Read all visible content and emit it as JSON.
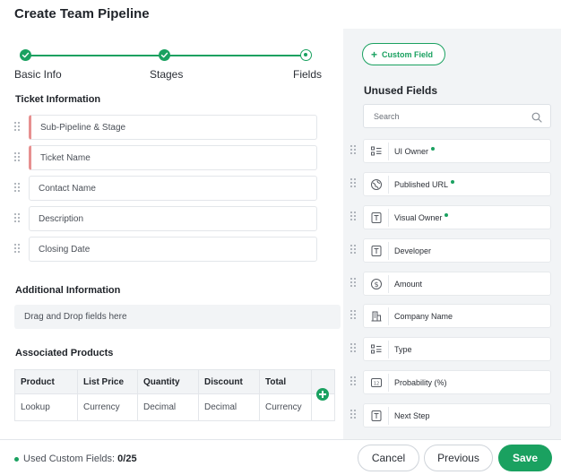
{
  "title": "Create Team Pipeline",
  "stepper": {
    "steps": [
      {
        "label": "Basic Info",
        "state": "done"
      },
      {
        "label": "Stages",
        "state": "done"
      },
      {
        "label": "Fields",
        "state": "current"
      }
    ]
  },
  "ticket_info": {
    "title": "Ticket Information",
    "fields": [
      {
        "label": "Sub-Pipeline & Stage",
        "required": true
      },
      {
        "label": "Ticket Name",
        "required": true
      },
      {
        "label": "Contact Name",
        "required": false
      },
      {
        "label": "Description",
        "required": false
      },
      {
        "label": "Closing Date",
        "required": false
      }
    ]
  },
  "additional_info": {
    "title": "Additional Information",
    "drop_text": "Drag and Drop fields here"
  },
  "products": {
    "title": "Associated Products",
    "columns": [
      "Product",
      "List Price",
      "Quantity",
      "Discount",
      "Total"
    ],
    "row": [
      "Lookup",
      "Currency",
      "Decimal",
      "Decimal",
      "Currency"
    ]
  },
  "right_panel": {
    "custom_field_button": "Custom Field",
    "unused_title": "Unused Fields",
    "search_placeholder": "Search",
    "items": [
      {
        "label": "UI Owner",
        "icon": "picklist-icon",
        "custom": true
      },
      {
        "label": "Published URL",
        "icon": "globe-icon",
        "custom": true
      },
      {
        "label": "Visual Owner",
        "icon": "text-field-icon",
        "custom": true
      },
      {
        "label": "Developer",
        "icon": "text-field-icon",
        "custom": false
      },
      {
        "label": "Amount",
        "icon": "currency-icon",
        "custom": false
      },
      {
        "label": "Company Name",
        "icon": "building-icon",
        "custom": false
      },
      {
        "label": "Type",
        "icon": "picklist-icon",
        "custom": false
      },
      {
        "label": "Probability (%)",
        "icon": "number-icon",
        "custom": false
      },
      {
        "label": "Next Step",
        "icon": "text-field-icon",
        "custom": false
      }
    ]
  },
  "footer": {
    "used_label": "Used Custom Fields:",
    "used_value": "0/25",
    "cancel": "Cancel",
    "previous": "Previous",
    "save": "Save"
  },
  "colors": {
    "accent": "#1aa160",
    "required": "#e79090",
    "panel_bg": "#f2f4f6"
  }
}
